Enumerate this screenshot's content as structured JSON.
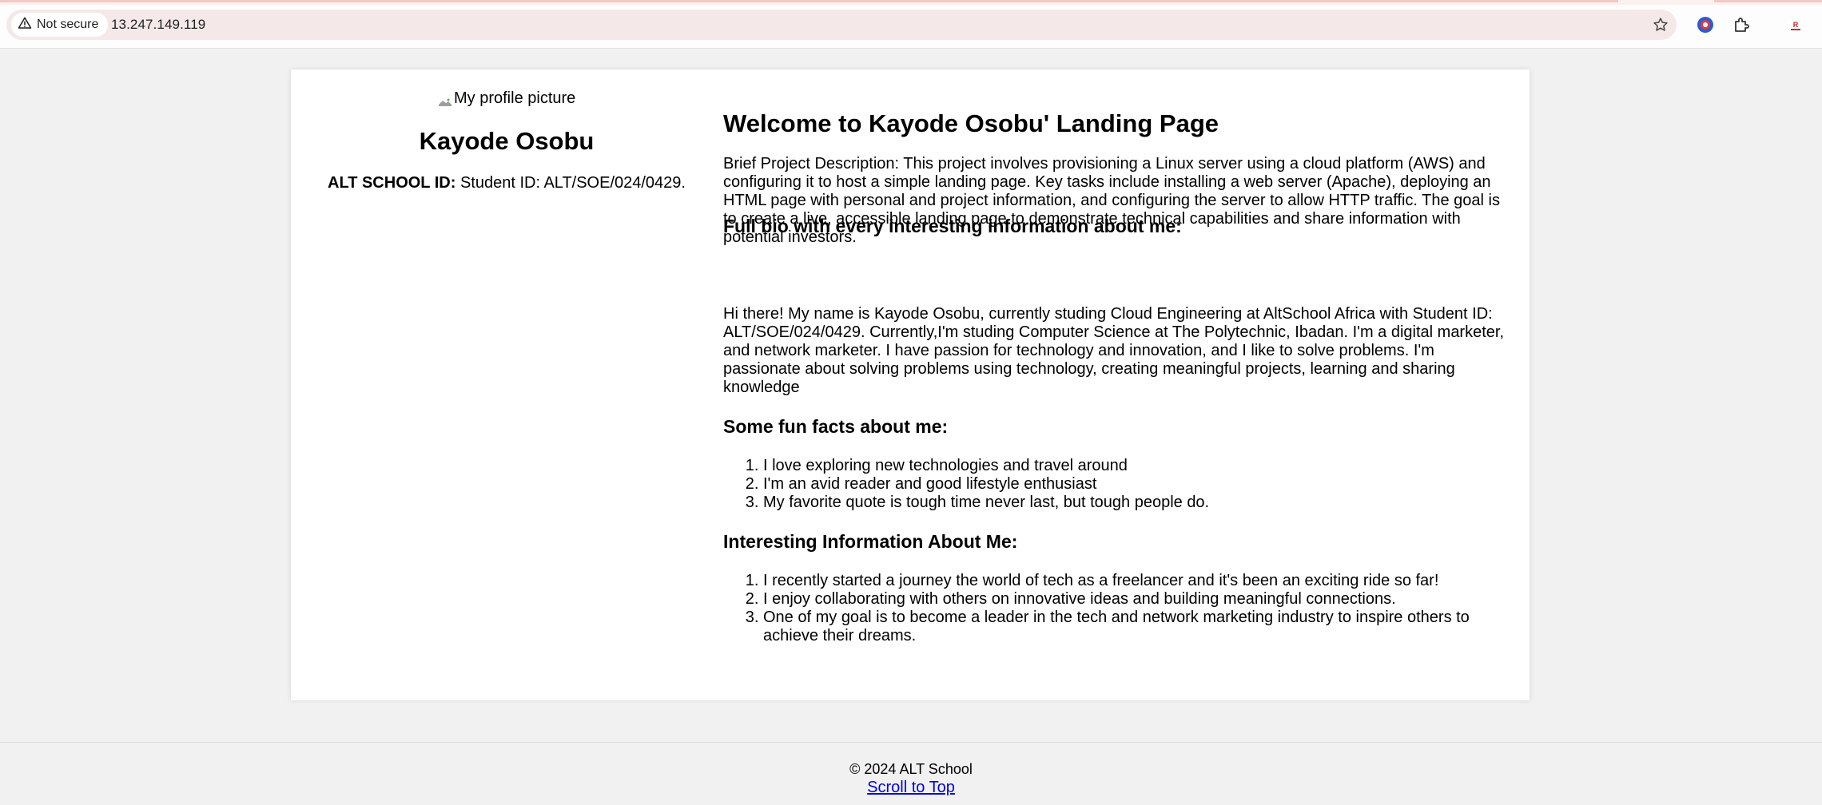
{
  "browser": {
    "security_label": "Not secure",
    "url": "13.247.149.119",
    "icons": [
      "warning-icon",
      "star-icon",
      "extension-globe-icon",
      "extensions-puzzle-icon",
      "profile-icon"
    ]
  },
  "profile": {
    "image_alt": "My profile picture",
    "name": "Kayode Osobu",
    "id_label": "ALT SCHOOL ID:",
    "id_value": "Student ID: ALT/SOE/024/0429."
  },
  "main": {
    "title": "Welcome to Kayode Osobu' Landing Page",
    "description": "Brief Project Description: This project involves provisioning a Linux server using a cloud platform (AWS) and configuring it to host a simple landing page. Key tasks include installing a web server (Apache), deploying an HTML page with personal and project information, and configuring the server to allow HTTP traffic. The goal is to create a live, accessible landing page to demonstrate technical capabilities and share information with potential investors.",
    "bio_heading": "Full bio with every interesting information about me:",
    "bio": "Hi there! My name is Kayode Osobu, currently studing Cloud Engineering at AltSchool Africa with Student ID: ALT/SOE/024/0429. Currently,I'm studing Computer Science at The Polytechnic, Ibadan. I'm a digital marketer, and network marketer. I have passion for technology and innovation, and I like to solve problems. I'm passionate about solving problems using technology, creating meaningful projects, learning and sharing knowledge",
    "facts_heading": "Some fun facts about me:",
    "facts": [
      "I love exploring new technologies and travel around",
      "I'm an avid reader and good lifestyle enthusiast",
      "My favorite quote is tough time never last, but tough people do."
    ],
    "info_heading": "Interesting Information About Me:",
    "info": [
      "I recently started a journey the world of tech as a freelancer and it's been an exciting ride so far!",
      "I enjoy collaborating with others on innovative ideas and building meaningful connections.",
      "One of my goal is to become a leader in the tech and network marketing industry to inspire others to achieve their dreams."
    ]
  },
  "footer": {
    "copyright": "© 2024 ALT School",
    "scroll_link": "Scroll to Top"
  },
  "colors": {
    "page_bg": "#f1f1f1",
    "card_bg": "#ffffff",
    "link": "#0000ee",
    "omnibox": "#f4e9e8"
  }
}
